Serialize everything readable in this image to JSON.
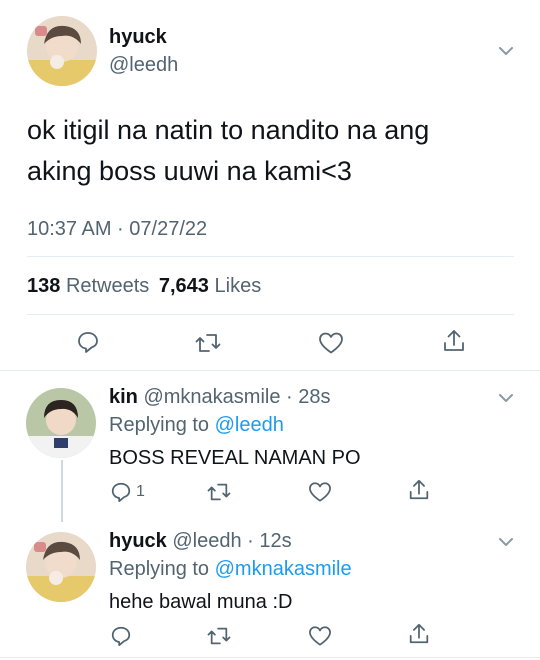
{
  "main_tweet": {
    "display_name": "hyuck",
    "handle": "@leedh",
    "text_line1": "ok itigil na natin to nandito na ang",
    "text_line2": "aking boss uuwi na kami<3",
    "timestamp": "10:37 AM · 07/27/22",
    "retweets_count": "138",
    "retweets_label": "Retweets",
    "likes_count": "7,643",
    "likes_label": "Likes"
  },
  "replies": [
    {
      "display_name": "kin",
      "handle_time": "@mknakasmile · 28s",
      "replying_prefix": "Replying to",
      "replying_to": "@leedh",
      "text": "BOSS REVEAL NAMAN PO",
      "reply_count": "1"
    },
    {
      "display_name": "hyuck",
      "handle_time": "@leedh · 12s",
      "replying_prefix": "Replying to",
      "replying_to": "@mknakasmile",
      "text": "hehe bawal muna :D",
      "reply_count": ""
    }
  ],
  "icons": [
    "chevron-down-icon",
    "reply-icon",
    "retweet-icon",
    "like-icon",
    "share-icon"
  ],
  "colors": {
    "link": "#1d9bf0",
    "secondary_text": "#536471",
    "divider": "#e6ecf0"
  }
}
